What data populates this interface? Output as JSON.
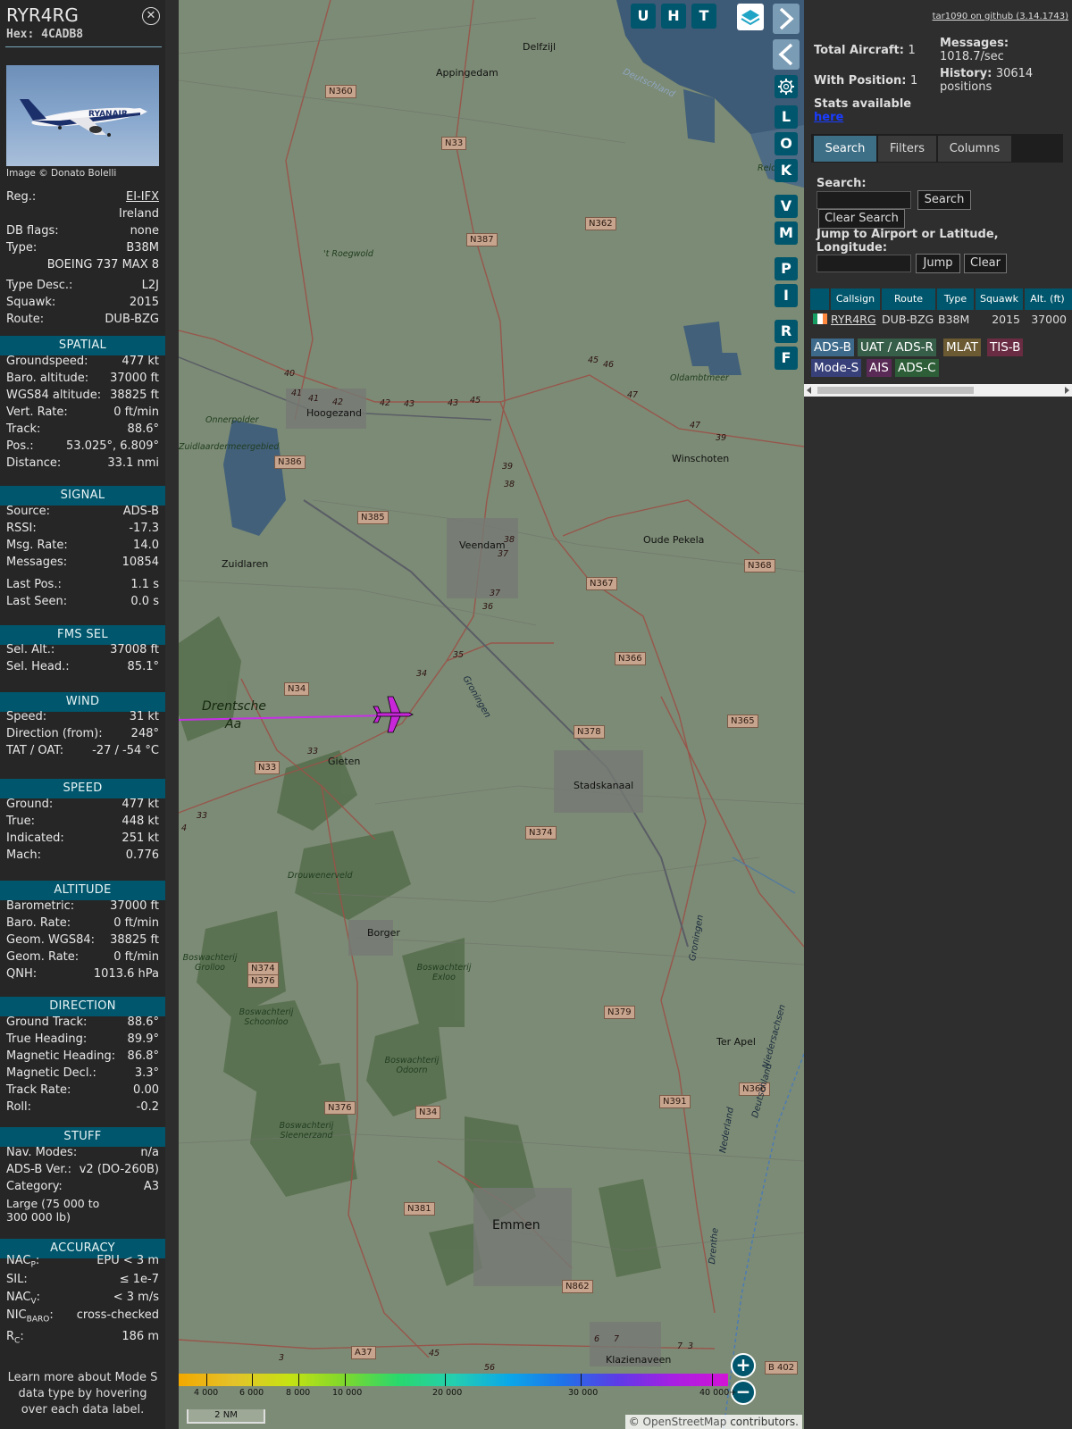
{
  "left": {
    "callsign": "RYR4RG",
    "hex_label": "Hex:",
    "hex": "4CADB8",
    "photo_airline_text": "RYANAIR",
    "photo_credit": "Image © Donato Bolelli",
    "basic": [
      {
        "k": "Reg.:",
        "v": "EI-IFX"
      },
      {
        "k": "",
        "v": "Ireland"
      },
      {
        "k": "DB flags:",
        "v": "none"
      },
      {
        "k": "Type:",
        "v": "B38M"
      },
      {
        "k": "",
        "v": "BOEING 737 MAX 8"
      },
      {
        "k": "Type Desc.:",
        "v": "L2J"
      },
      {
        "k": "Squawk:",
        "v": "2015"
      },
      {
        "k": "Route:",
        "v": "DUB-BZG"
      }
    ],
    "sections": [
      {
        "title": "SPATIAL",
        "rows": [
          {
            "k": "Groundspeed:",
            "v": "477 kt"
          },
          {
            "k": "Baro. altitude:",
            "v": "37000 ft"
          },
          {
            "k": "WGS84 altitude:",
            "v": "38825 ft"
          },
          {
            "k": "Vert. Rate:",
            "v": "0 ft/min"
          },
          {
            "k": "Track:",
            "v": "88.6°"
          },
          {
            "k": "Pos.:",
            "v": "53.025°, 6.809°"
          },
          {
            "k": "Distance:",
            "v": "33.1 nmi"
          }
        ]
      },
      {
        "title": "SIGNAL",
        "rows": [
          {
            "k": "Source:",
            "v": "ADS-B"
          },
          {
            "k": "RSSI:",
            "v": "-17.3"
          },
          {
            "k": "Msg. Rate:",
            "v": "14.0"
          },
          {
            "k": "Messages:",
            "v": "10854"
          },
          {
            "k": "Last Pos.:",
            "v": "1.1 s"
          },
          {
            "k": "Last Seen:",
            "v": "0.0 s"
          }
        ]
      },
      {
        "title": "FMS SEL",
        "rows": [
          {
            "k": "Sel. Alt.:",
            "v": "37008 ft"
          },
          {
            "k": "Sel. Head.:",
            "v": "85.1°"
          }
        ]
      },
      {
        "title": "WIND",
        "rows": [
          {
            "k": "Speed:",
            "v": "31 kt"
          },
          {
            "k": "Direction (from):",
            "v": "248°"
          },
          {
            "k": "TAT / OAT:",
            "v": "-27 / -54 °C"
          }
        ]
      },
      {
        "title": "SPEED",
        "rows": [
          {
            "k": "Ground:",
            "v": "477 kt"
          },
          {
            "k": "True:",
            "v": "448 kt"
          },
          {
            "k": "Indicated:",
            "v": "251 kt"
          },
          {
            "k": "Mach:",
            "v": "0.776"
          }
        ]
      },
      {
        "title": "ALTITUDE",
        "rows": [
          {
            "k": "Barometric:",
            "v": "37000 ft"
          },
          {
            "k": "Baro. Rate:",
            "v": "0 ft/min"
          },
          {
            "k": "Geom. WGS84:",
            "v": "38825 ft"
          },
          {
            "k": "Geom. Rate:",
            "v": "0 ft/min"
          },
          {
            "k": "QNH:",
            "v": "1013.6 hPa"
          }
        ]
      },
      {
        "title": "DIRECTION",
        "rows": [
          {
            "k": "Ground Track:",
            "v": "88.6°"
          },
          {
            "k": "True Heading:",
            "v": "89.9°"
          },
          {
            "k": "Magnetic Heading:",
            "v": "86.8°"
          },
          {
            "k": "Magnetic Decl.:",
            "v": "3.3°"
          },
          {
            "k": "Track Rate:",
            "v": "0.00"
          },
          {
            "k": "Roll:",
            "v": "-0.2"
          }
        ]
      },
      {
        "title": "STUFF",
        "rows": [
          {
            "k": "Nav. Modes:",
            "v": "n/a"
          },
          {
            "k": "ADS-B Ver.:",
            "v": "v2 (DO-260B)"
          },
          {
            "k": "Category:",
            "v": "A3"
          }
        ]
      },
      {
        "title": "ACCURACY",
        "rows": []
      }
    ],
    "category_desc_1": "Large (75 000 to",
    "category_desc_2": "300 000 lb)",
    "accuracy": {
      "nacp_k": "NAC",
      "nacp_sub": "P",
      "nacp_v": "EPU < 3 m",
      "sil_k": "SIL:",
      "sil_v": "≤ 1e-7",
      "nacv_k": "NAC",
      "nacv_sub": "V",
      "nacv_v": "< 3 m/s",
      "nicbaro_k": "NIC",
      "nicbaro_sub": "BARO",
      "nicbaro_v": "cross-checked",
      "rc_k": "R",
      "rc_sub": "C",
      "rc_v": "186 m"
    },
    "note": "Learn more about Mode S data type by hovering over each data label."
  },
  "map": {
    "top_buttons": [
      "U",
      "H",
      "T"
    ],
    "side_buttons": [
      "L",
      "O",
      "K",
      "V",
      "M",
      "P",
      "I",
      "R",
      "F"
    ],
    "places": [
      {
        "name": "Delfzijl"
      },
      {
        "name": "Appingedam"
      },
      {
        "name": "Hoogezand"
      },
      {
        "name": "Winschoten"
      },
      {
        "name": "Veendam"
      },
      {
        "name": "Oude Pekela"
      },
      {
        "name": "Zuidlaren"
      },
      {
        "name": "Gieten"
      },
      {
        "name": "Stadskanaal"
      },
      {
        "name": "Borger"
      },
      {
        "name": "Ter Apel"
      },
      {
        "name": "Emmen"
      },
      {
        "name": "Klazienaveen"
      },
      {
        "name": "Drentsche"
      },
      {
        "name": "Aa"
      }
    ],
    "nature": [
      "'t Roegwold",
      "Onnerpolder",
      "Zuidlaardermeergebied",
      "Oldambtmeer",
      "Drouwenerveld",
      "Boswachterij Grolloo",
      "Boswachterij Schoonloo",
      "Boswachterij Exloo",
      "Boswachterij Odoorn",
      "Boswachterij Sleenerzand",
      "Reide"
    ],
    "roads": [
      "N360",
      "N33",
      "N362",
      "N387",
      "N386",
      "N385",
      "N367",
      "N368",
      "N366",
      "N34",
      "N365",
      "N378",
      "N33",
      "N374",
      "N374",
      "N376",
      "N379",
      "N376",
      "N34",
      "N391",
      "N366",
      "N381",
      "N862",
      "A37",
      "B 402"
    ],
    "road_numbers": [
      "40",
      "41",
      "41",
      "42",
      "42",
      "43",
      "43",
      "45",
      "45",
      "46",
      "47",
      "47",
      "39",
      "39",
      "38",
      "38",
      "37",
      "37",
      "36",
      "35",
      "34",
      "33",
      "33",
      "4",
      "4",
      "5",
      "5",
      "6",
      "6",
      "7",
      "7",
      "3",
      "3"
    ],
    "water_labels": [
      "Deutschland",
      "Groningen",
      "Groningen",
      "Niedersachsen",
      "Nederland",
      "Deutschland",
      "Drenthe"
    ],
    "altitude_scale": [
      "4 000",
      "6 000",
      "8 000",
      "10 000",
      "20 000",
      "30 000",
      "40 000+"
    ],
    "scale_colors": [
      "#f2a900",
      "#e4c22a",
      "#c7e212",
      "#7fd82c",
      "#29d86d",
      "#24cfaf",
      "#0ba8e8",
      "#1f72e8",
      "#5e3ae6",
      "#a71fe2",
      "#d214d6"
    ],
    "distance_scale": "2 NM",
    "attribution_prefix": "©",
    "attribution_link": "OpenStreetMap",
    "attribution_suffix": "contributors.",
    "aircraft_color": "#c827d9",
    "trail_color": "#c730e6"
  },
  "right": {
    "github_link": "tar1090 on github (3.14.1743)",
    "total_aircraft_k": "Total Aircraft:",
    "total_aircraft_v": "1",
    "with_position_k": "With Position:",
    "with_position_v": "1",
    "messages_k": "Messages:",
    "messages_v": "1018.7/sec",
    "history_k": "History:",
    "history_v": "30614",
    "history_unit": "positions",
    "stats_text": "Stats available",
    "stats_link": "here",
    "tabs": [
      "Search",
      "Filters",
      "Columns"
    ],
    "search_label": "Search:",
    "search_button": "Search",
    "clear_search_button": "Clear Search",
    "jump_label_1": "Jump to Airport or Latitude,",
    "jump_label_2": "Longitude:",
    "jump_button": "Jump",
    "clear_button": "Clear",
    "table_headers": [
      "Callsign",
      "Route",
      "Type",
      "Squawk",
      "Alt. (ft)"
    ],
    "table_row": {
      "callsign": "RYR4RG",
      "route": "DUB-BZG",
      "type": "B38M",
      "squawk": "2015",
      "alt": "37000"
    },
    "source_chips": [
      {
        "label": "ADS-B",
        "bg": "#3d6a8a",
        "fg": "#ffffff"
      },
      {
        "label": "UAT / ADS-R",
        "bg": "#365e48",
        "fg": "#ffffff"
      },
      {
        "label": "MLAT",
        "bg": "#6b5a32",
        "fg": "#ffffff"
      },
      {
        "label": "TIS-B",
        "bg": "#6a2c42",
        "fg": "#ffffff"
      },
      {
        "label": "Mode-S",
        "bg": "#38407a",
        "fg": "#ffffff"
      },
      {
        "label": "AIS",
        "bg": "#5a2a56",
        "fg": "#ffffff"
      },
      {
        "label": "ADS-C",
        "bg": "#2e5e38",
        "fg": "#ffffff"
      }
    ]
  }
}
